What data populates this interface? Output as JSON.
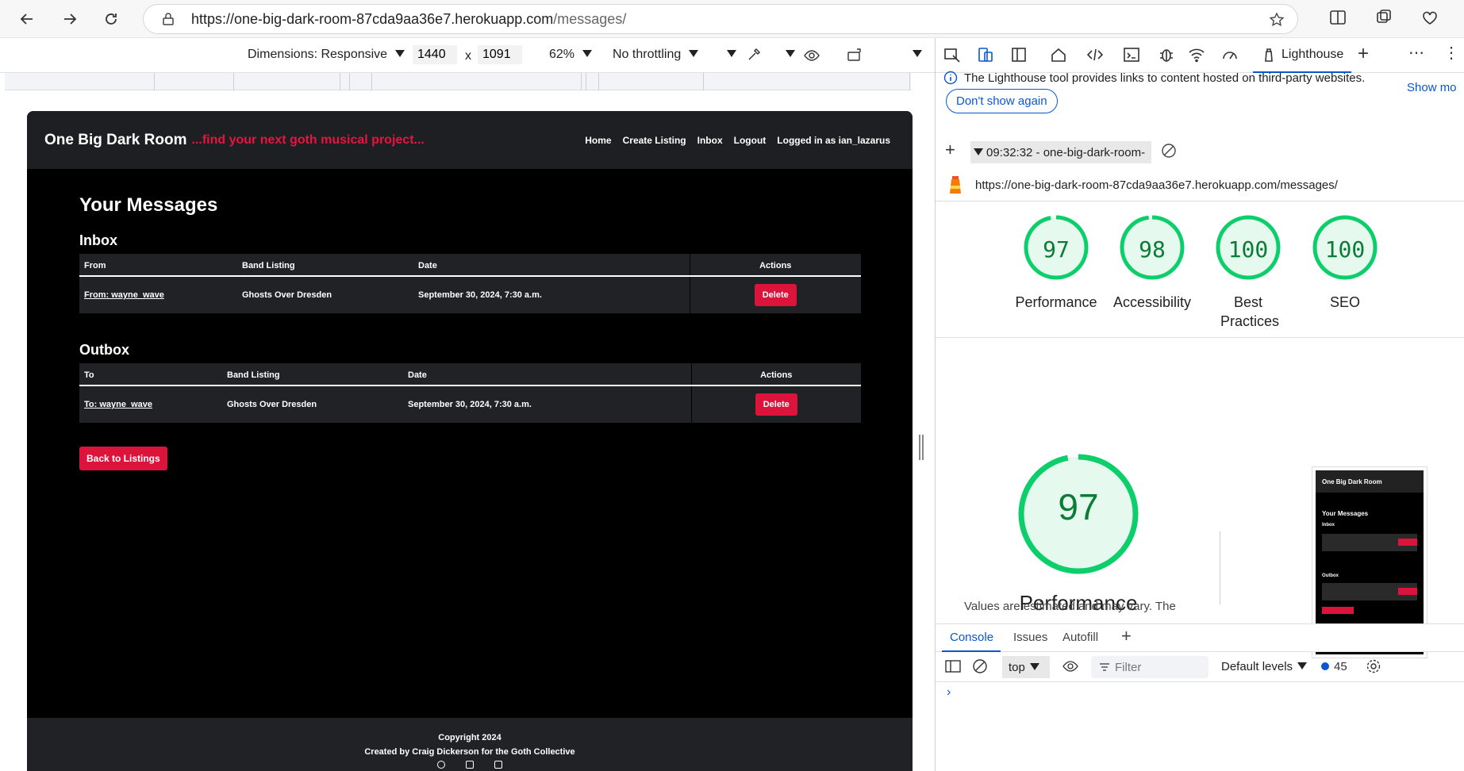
{
  "browser": {
    "url_main": "https://one-big-dark-room-87cda9aa36e7.herokuapp.com",
    "url_path": "/messages/"
  },
  "device_toolbar": {
    "dimensions_label": "Dimensions: Responsive",
    "width": "1440",
    "separator": "x",
    "height": "1091",
    "zoom": "62%",
    "throttling": "No throttling"
  },
  "site": {
    "brand": "One Big Dark Room",
    "tagline": "...find your next goth musical project...",
    "nav": [
      "Home",
      "Create Listing",
      "Inbox",
      "Logout",
      "Logged in as ian_lazarus"
    ],
    "page_title": "Your Messages",
    "inbox": {
      "heading": "Inbox",
      "columns": [
        "From",
        "Band Listing",
        "Date",
        "Actions"
      ],
      "rows": [
        {
          "who": "From: wayne_wave",
          "band": "Ghosts Over Dresden",
          "date": "September 30, 2024, 7:30 a.m.",
          "action": "Delete"
        }
      ]
    },
    "outbox": {
      "heading": "Outbox",
      "columns": [
        "To",
        "Band Listing",
        "Date",
        "Actions"
      ],
      "rows": [
        {
          "who": "To: wayne_wave",
          "band": "Ghosts Over Dresden",
          "date": "September 30, 2024, 7:30 a.m.",
          "action": "Delete"
        }
      ]
    },
    "back_button": "Back to Listings",
    "footer": {
      "copyright": "Copyright 2024",
      "credit": "Created by Craig Dickerson for the Goth Collective"
    }
  },
  "devtools": {
    "active_tab": "Lighthouse",
    "info_message": "The Lighthouse tool provides links to content hosted on third-party websites.",
    "show_more": "Show mo",
    "dont_show_again": "Don't show again",
    "report_select": "09:32:32 - one-big-dark-room-",
    "report_url": "https://one-big-dark-room-87cda9aa36e7.herokuapp.com/messages/",
    "scores": [
      {
        "label": "Performance",
        "value": 97
      },
      {
        "label": "Accessibility",
        "value": 98
      },
      {
        "label": "Best Practices",
        "value": 100
      },
      {
        "label": "SEO",
        "value": 100
      }
    ],
    "big_score": {
      "label": "Performance",
      "value": 97
    },
    "note": "Values are estimated and may vary. The",
    "thumbnail": {
      "brand": "One Big Dark Room",
      "title": "Your Messages",
      "inbox": "Inbox",
      "outbox": "Outbox"
    },
    "drawer_tabs": [
      "Console",
      "Issues",
      "Autofill"
    ],
    "console": {
      "context": "top",
      "filter_placeholder": "Filter",
      "levels": "Default levels",
      "issue_count": "45"
    },
    "colors": {
      "score_good": "#0cce6b",
      "accent": "#0b57d0",
      "delete": "#dc143c"
    }
  }
}
